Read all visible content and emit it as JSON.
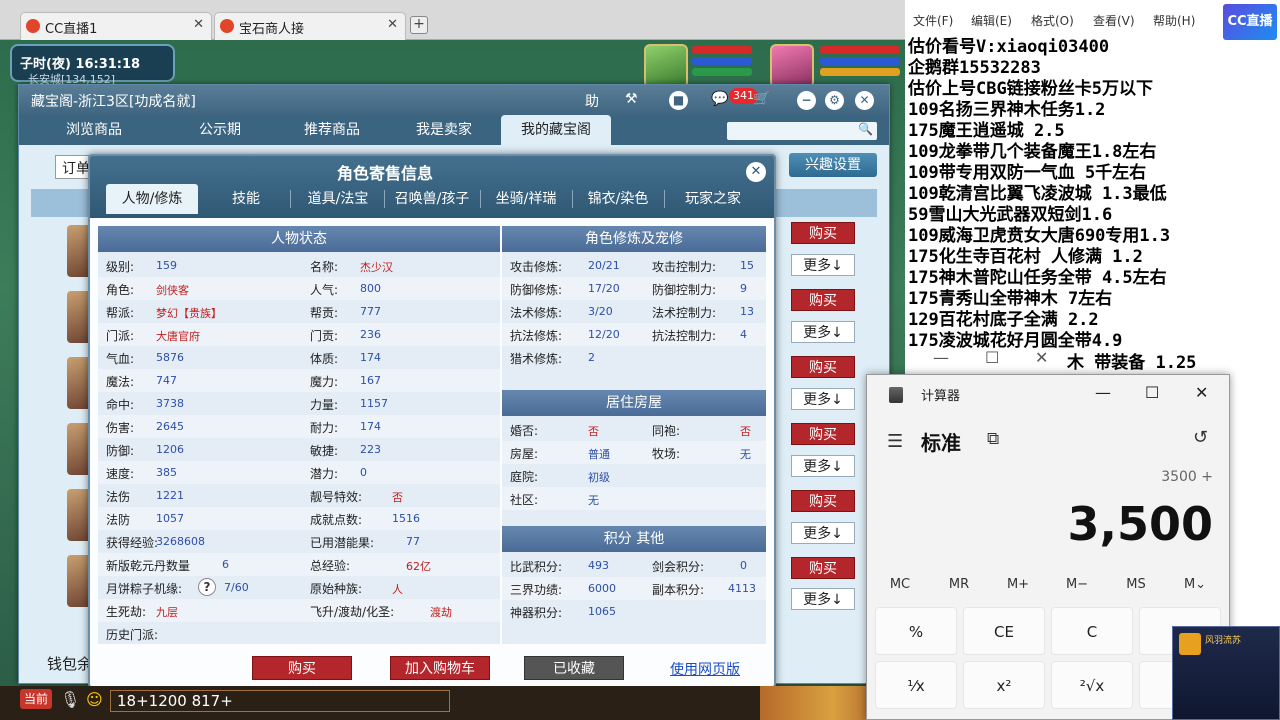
{
  "browser": {
    "tabs": [
      {
        "label": "CC直播1"
      },
      {
        "label": "宝石商人接"
      }
    ],
    "new_tab": "+"
  },
  "game_hud": {
    "time": "子时(夜)  16:31:18",
    "location": "长安城[134,152]"
  },
  "cbg": {
    "title": "藏宝阁-浙江3区[功成名就]",
    "help_label": "助",
    "cart_count": "341",
    "nav": [
      "浏览商品",
      "公示期",
      "推荐商品",
      "我是卖家",
      "我的藏宝阁"
    ],
    "sort_label": "订单",
    "interest_button": "兴趣设置",
    "buy_label": "购买",
    "more_label": "更多↓",
    "wallet_label": "钱包余"
  },
  "dialog": {
    "title": "角色寄售信息",
    "tabs": [
      "人物/修炼",
      "技能",
      "道具/法宝",
      "召唤兽/孩子",
      "坐骑/祥瑞",
      "锦衣/染色",
      "玩家之家"
    ],
    "status_header": "人物状态",
    "left_col": [
      {
        "label": "级别:",
        "value": "159"
      },
      {
        "label": "角色:",
        "value": "剑侠客"
      },
      {
        "label": "帮派:",
        "value": "梦幻【贵族】"
      },
      {
        "label": "门派:",
        "value": "大唐官府"
      },
      {
        "label": "气血:",
        "value": "5876"
      },
      {
        "label": "魔法:",
        "value": "747"
      },
      {
        "label": "命中:",
        "value": "3738"
      },
      {
        "label": "伤害:",
        "value": "2645"
      },
      {
        "label": "防御:",
        "value": "1206"
      },
      {
        "label": "速度:",
        "value": "385"
      },
      {
        "label": "法伤",
        "value": "1221"
      },
      {
        "label": "法防",
        "value": "1057"
      },
      {
        "label": "获得经验:",
        "value": "3268608"
      },
      {
        "label": "新版乾元丹数量",
        "value": "6"
      },
      {
        "label": "月饼粽子机缘:",
        "value": "7/60"
      },
      {
        "label": "生死劫:",
        "value": "九层"
      },
      {
        "label": "历史门派:",
        "value": ""
      }
    ],
    "mid_col": [
      {
        "label": "名称:",
        "value": "杰少汉"
      },
      {
        "label": "人气:",
        "value": "800"
      },
      {
        "label": "帮贡:",
        "value": "777"
      },
      {
        "label": "门贡:",
        "value": "236"
      },
      {
        "label": "体质:",
        "value": "174"
      },
      {
        "label": "魔力:",
        "value": "167"
      },
      {
        "label": "力量:",
        "value": "1157"
      },
      {
        "label": "耐力:",
        "value": "174"
      },
      {
        "label": "敏捷:",
        "value": "223"
      },
      {
        "label": "潜力:",
        "value": "0"
      },
      {
        "label": "靓号特效:",
        "value": "否"
      },
      {
        "label": "成就点数:",
        "value": "1516"
      },
      {
        "label": "已用潜能果:",
        "value": "77"
      },
      {
        "label": "总经验:",
        "value": "62亿"
      },
      {
        "label": "原始种族:",
        "value": "人"
      },
      {
        "label": "飞升/渡劫/化圣:",
        "value": "渡劫"
      }
    ],
    "cultivation_header": "角色修炼及宠修",
    "cultivation": [
      {
        "label": "攻击修炼:",
        "value": "20/21",
        "label2": "攻击控制力:",
        "value2": "15"
      },
      {
        "label": "防御修炼:",
        "value": "17/20",
        "label2": "防御控制力:",
        "value2": "9"
      },
      {
        "label": "法术修炼:",
        "value": "3/20",
        "label2": "法术控制力:",
        "value2": "13"
      },
      {
        "label": "抗法修炼:",
        "value": "12/20",
        "label2": "抗法控制力:",
        "value2": "4"
      },
      {
        "label": "猎术修炼:",
        "value": "2",
        "label2": "",
        "value2": ""
      }
    ],
    "house_header": "居住房屋",
    "house": [
      {
        "label": "婚否:",
        "value": "否",
        "label2": "同袍:",
        "value2": "否"
      },
      {
        "label": "房屋:",
        "value": "普通",
        "label2": "牧场:",
        "value2": "无"
      },
      {
        "label": "庭院:",
        "value": "初级",
        "label2": "",
        "value2": ""
      },
      {
        "label": "社区:",
        "value": "无",
        "label2": "",
        "value2": ""
      }
    ],
    "score_header": "积分 其他",
    "score": [
      {
        "label": "比武积分:",
        "value": "493",
        "label2": "剑会积分:",
        "value2": "0"
      },
      {
        "label": "三界功绩:",
        "value": "6000",
        "label2": "副本积分:",
        "value2": "4113"
      },
      {
        "label": "神器积分:",
        "value": "1065",
        "label2": "",
        "value2": ""
      }
    ],
    "footer": {
      "buy": "购买",
      "add_cart": "加入购物车",
      "collected": "已收藏",
      "web_version": "使用网页版"
    }
  },
  "gamebar": {
    "current_tab": "当前",
    "chat_text": "18+1200  817+"
  },
  "notepad": {
    "menu": [
      "文件(F)",
      "编辑(E)",
      "格式(O)",
      "查看(V)",
      "帮助(H)"
    ],
    "logo": "CC直播",
    "lines": [
      "估价看号V:xiaoqi03400",
      "企鹅群15532283",
      "估价上号CBG链接粉丝卡5万以下",
      "109名扬三界神木任务1.2",
      "175魔王逍遥城 2.5",
      "109龙拳带几个装备魔王1.8左右",
      "109带专用双防一气血 5千左右",
      "109乾清宫比翼飞凌波城 1.3最低",
      "59雪山大光武器双短剑1.6",
      "109威海卫虎贲女大唐690专用1.3",
      "175化生寺百花村 人修满 1.2",
      "175神木普陀山任务全带 4.5左右",
      "175青秀山全带神木  7左右",
      "129百花村底子全满 2.2",
      "175凌波城花好月圆全带4.9"
    ],
    "partial_line": "木 带装备  1.25"
  },
  "calculator": {
    "title": "计算器",
    "mode": "标准",
    "expression": "3500 +",
    "display": "3,500",
    "memory": [
      "MC",
      "MR",
      "M+",
      "M−",
      "MS",
      "M⌄"
    ],
    "keys_row1": [
      "%",
      "CE",
      "C",
      ""
    ],
    "keys_row2": [
      "¹⁄x",
      "x²",
      "²√x",
      ""
    ]
  },
  "overlay": {
    "name": "风羽流苏"
  }
}
